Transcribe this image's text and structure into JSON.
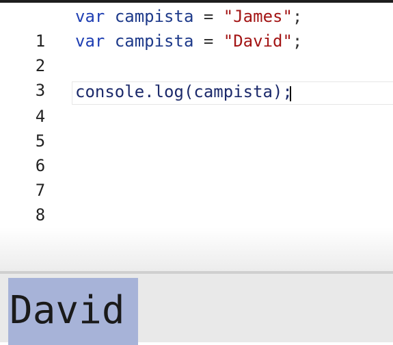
{
  "editor": {
    "lines": [
      {
        "number": "1",
        "keyword": "var",
        "identifier": "campista",
        "operator": "=",
        "string": "\"James\"",
        "end": ";"
      },
      {
        "number": "2",
        "keyword": "var",
        "identifier": "campista",
        "operator": "=",
        "string": "\"David\"",
        "end": ";"
      },
      {
        "number": "3"
      },
      {
        "number": "4",
        "code": "console.log(campista);"
      },
      {
        "number": "5"
      },
      {
        "number": "6"
      },
      {
        "number": "7"
      },
      {
        "number": "8"
      }
    ]
  },
  "console": {
    "output": "David"
  },
  "colors": {
    "keyword": "#1f3fb3",
    "identifier": "#1e3a8a",
    "string": "#a31515",
    "selection": "#a7b3d8"
  }
}
